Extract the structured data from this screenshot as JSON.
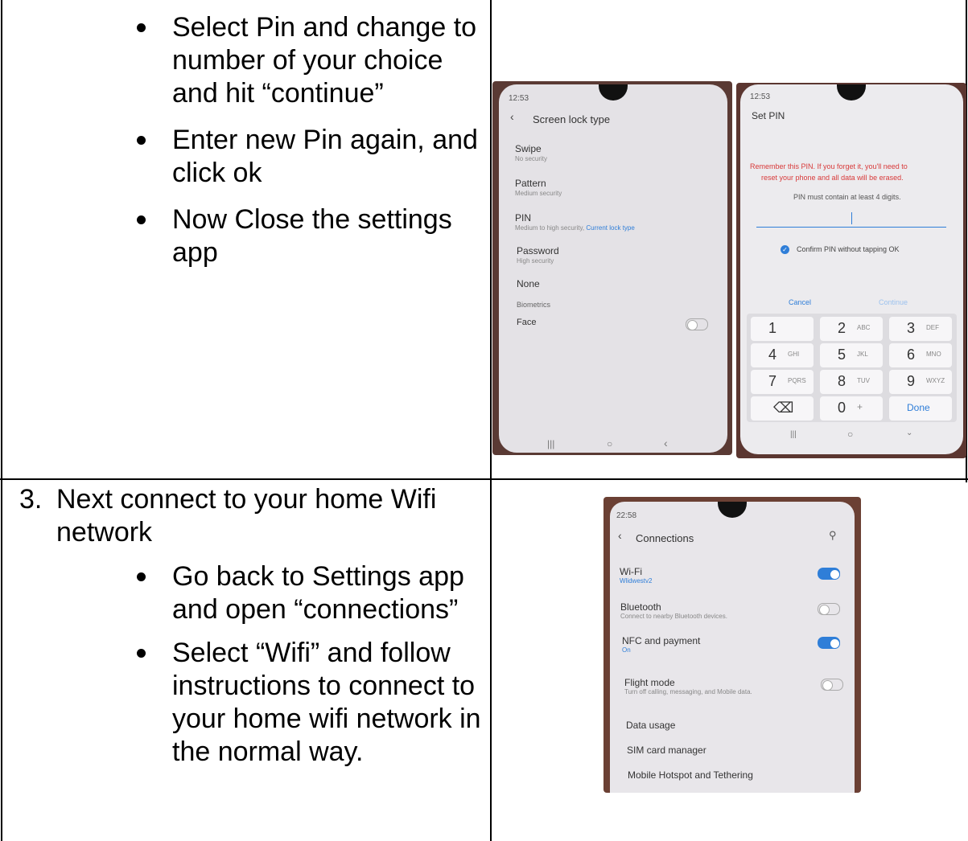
{
  "row1": {
    "bullets": [
      "Select Pin and change to number of your choice and hit “continue”",
      "Enter new Pin again, and click ok",
      "Now Close the settings app"
    ]
  },
  "row2": {
    "step_number": "3.",
    "step_text": "Next connect to your home Wifi network",
    "bullets": [
      "Go back to Settings app and open “connections”",
      "Select “Wifi” and follow instructions to connect to your home wifi network in the normal way."
    ]
  },
  "phone1": {
    "time": "12:53",
    "title": "Screen lock type",
    "items": [
      {
        "label": "Swipe",
        "sub": "No security"
      },
      {
        "label": "Pattern",
        "sub": "Medium security"
      },
      {
        "label": "PIN",
        "sub": "Medium to high security",
        "sub_extra": "Current lock type"
      },
      {
        "label": "Password",
        "sub": "High security"
      },
      {
        "label": "None",
        "sub": ""
      }
    ],
    "section": "Biometrics",
    "face_label": "Face"
  },
  "phone2": {
    "time": "12:53",
    "title": "Set PIN",
    "warning_line1": "Remember this PIN. If you forget it, you'll need to",
    "warning_line2": "reset your phone and all data will be erased.",
    "hint": "PIN must contain at least 4 digits.",
    "confirm": "Confirm PIN without tapping OK",
    "cancel": "Cancel",
    "continue": "Continue",
    "keys": [
      {
        "n": "1",
        "l": ""
      },
      {
        "n": "2",
        "l": "ABC"
      },
      {
        "n": "3",
        "l": "DEF"
      },
      {
        "n": "4",
        "l": "GHI"
      },
      {
        "n": "5",
        "l": "JKL"
      },
      {
        "n": "6",
        "l": "MNO"
      },
      {
        "n": "7",
        "l": "PQRS"
      },
      {
        "n": "8",
        "l": "TUV"
      },
      {
        "n": "9",
        "l": "WXYZ"
      },
      {
        "n": "⌫",
        "l": ""
      },
      {
        "n": "0",
        "l": "+"
      },
      {
        "n": "Done",
        "l": ""
      }
    ]
  },
  "phone3": {
    "time": "22:58",
    "title": "Connections",
    "items": [
      {
        "label": "Wi-Fi",
        "sub": "Wlidwestv2",
        "toggle": "on"
      },
      {
        "label": "Bluetooth",
        "sub": "Connect to nearby Bluetooth devices.",
        "toggle": "off"
      },
      {
        "label": "NFC and payment",
        "sub": "On",
        "toggle": "on"
      },
      {
        "label": "Flight mode",
        "sub": "Turn off calling, messaging, and Mobile data.",
        "toggle": "off"
      },
      {
        "label": "Data usage",
        "sub": ""
      },
      {
        "label": "SIM card manager",
        "sub": ""
      },
      {
        "label": "Mobile Hotspot and Tethering",
        "sub": ""
      }
    ]
  },
  "colors": {
    "accent": "#2f7ed8",
    "warning": "#d83a3a"
  }
}
